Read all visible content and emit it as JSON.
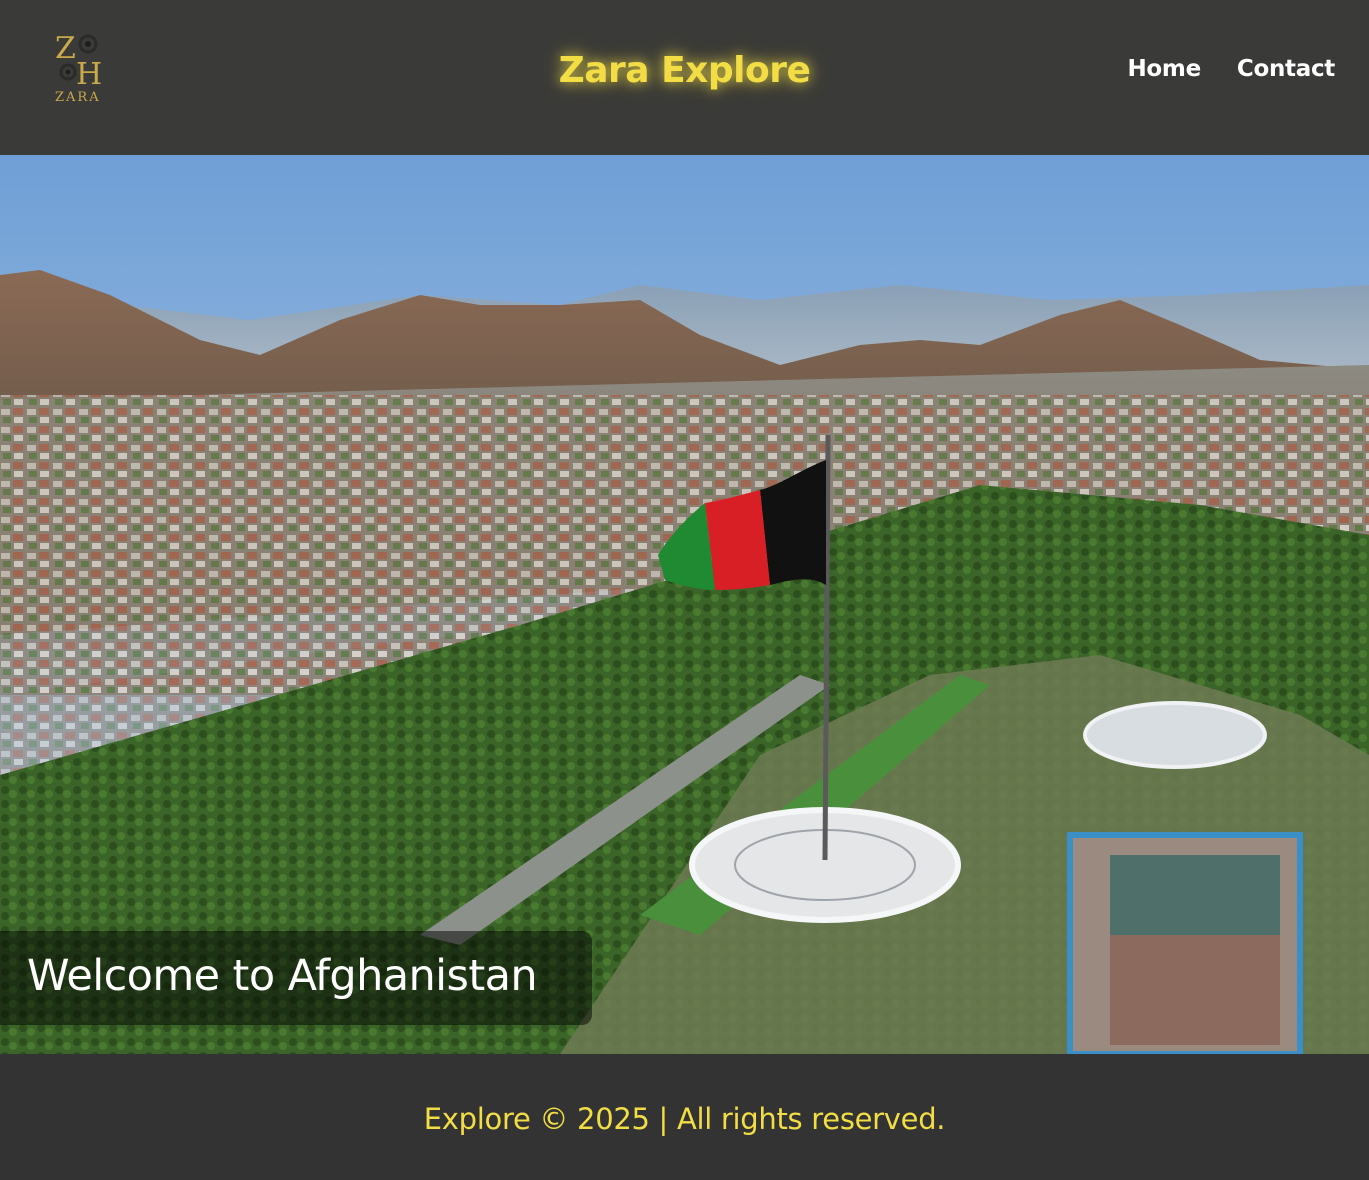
{
  "header": {
    "logo": {
      "text": "ZARA",
      "monogram": "ZH",
      "icon": "flower-monogram-logo"
    },
    "title": "Zara Explore",
    "nav": [
      {
        "label": "Home"
      },
      {
        "label": "Contact"
      }
    ]
  },
  "hero": {
    "image": "kabul-city-aerial-with-flag",
    "caption": "Welcome to Afghanistan"
  },
  "footer": {
    "text": "Explore © 2025 | All rights reserved."
  },
  "colors": {
    "header_bg": "#3a3a38",
    "footer_bg": "#333333",
    "accent": "#f2dd45",
    "nav_text": "#ffffff",
    "flag_black": "#111111",
    "flag_red": "#d91f26",
    "flag_green": "#1f8a32"
  }
}
